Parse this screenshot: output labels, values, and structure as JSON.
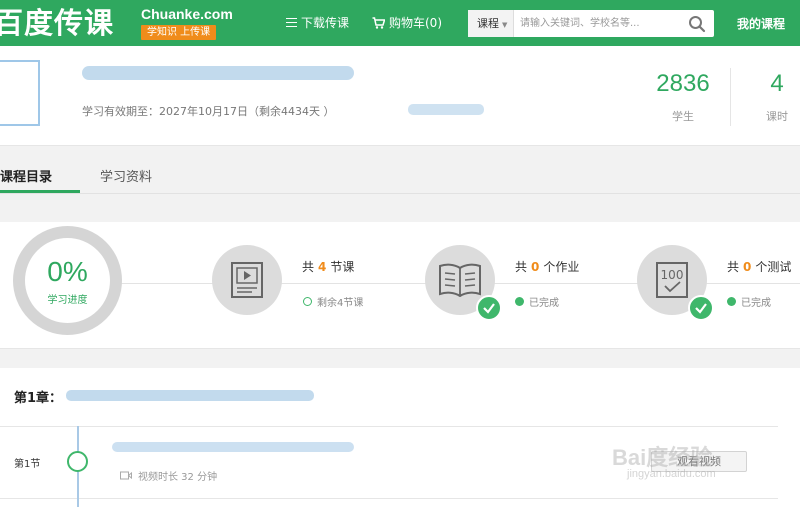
{
  "header": {
    "logo_cn": "百度传课",
    "logo_en": "Chuanke.com",
    "slogan": "学知识 上传课",
    "nav_download": "下载传课",
    "nav_cart": "购物车(0)",
    "search_category": "课程",
    "search_placeholder": "请输入关键词、学校名等...",
    "my_courses": "我的课程",
    "brand_color": "#2fa85f",
    "accent_color": "#f08c1b"
  },
  "course": {
    "validity": "学习有效期至：2027年10月17日（剩余4434天 ）",
    "students_count": "2836",
    "students_label": "学生",
    "hours_count": "4",
    "hours_label": "课时"
  },
  "tabs": {
    "catalog": "课程目录",
    "materials": "学习资料"
  },
  "progress": {
    "percent": "0%",
    "label": "学习进度",
    "lessons_prefix": "共",
    "lessons_count": "4",
    "lessons_suffix": "节课",
    "lessons_status": "剩余4节课",
    "homework_prefix": "共",
    "homework_count": "0",
    "homework_suffix": "个作业",
    "homework_status": "已完成",
    "tests_prefix": "共",
    "tests_count": "0",
    "tests_suffix": "个测试",
    "tests_status": "已完成",
    "icons": [
      "video-lesson-icon",
      "book-icon",
      "test-paper-icon",
      "check-icon"
    ]
  },
  "chapter": {
    "label": "第1章：",
    "section_label": "第1节",
    "duration": "视频时长 32 分钟",
    "watch_button": "观看视频"
  },
  "watermark": {
    "text": "Bai度经验",
    "sub": "jingyan.baidu.com"
  }
}
